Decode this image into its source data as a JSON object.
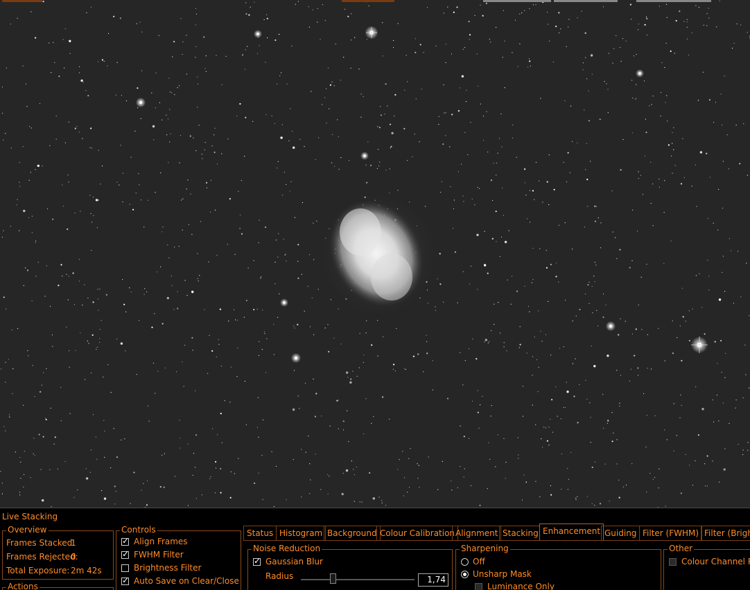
{
  "colors": {
    "accent": "#ff8c28",
    "border": "#8a4a1a",
    "panel_bg": "#000000",
    "sky": "#262626"
  },
  "viewer": {
    "name": "M27 Dumbbell Nebula star field"
  },
  "panel": {
    "title": "Live Stacking",
    "overview": {
      "label": "Overview",
      "frames_stacked_label": "Frames Stacked:",
      "frames_stacked_value": "1",
      "frames_rejected_label": "Frames Rejected:",
      "frames_rejected_value": "0",
      "total_exposure_label": "Total Exposure:",
      "total_exposure_value": "2m 42s"
    },
    "actions": {
      "label": "Actions"
    },
    "controls": {
      "label": "Controls",
      "align_frames": "Align Frames",
      "fwhm_filter": "FWHM Filter",
      "brightness_filter": "Brightness Filter",
      "auto_save": "Auto Save on Clear/Close"
    },
    "tabs": [
      "Status",
      "Histogram",
      "Background",
      "Colour Calibration",
      "Alignment",
      "Stacking",
      "Enhancement",
      "Guiding",
      "Filter (FWHM)",
      "Filter (Brightness)"
    ],
    "active_tab": "Enhancement",
    "noise_reduction": {
      "label": "Noise Reduction",
      "gaussian_blur": "Gaussian Blur",
      "radius_label": "Radius",
      "radius_value": "1,74",
      "radius_fraction": 0.28
    },
    "sharpening": {
      "label": "Sharpening",
      "off": "Off",
      "unsharp_mask": "Unsharp Mask",
      "luminance_only": "Luminance Only"
    },
    "other": {
      "label": "Other",
      "colour_channel": "Colour Channel Re"
    }
  }
}
